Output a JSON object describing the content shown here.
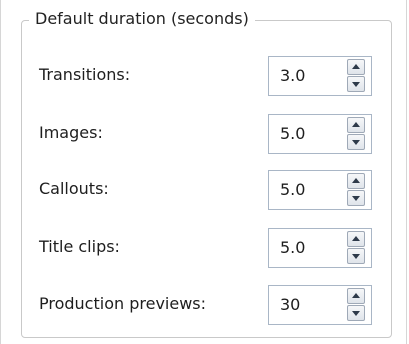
{
  "group": {
    "title": "Default duration (seconds)"
  },
  "fields": [
    {
      "label": "Transitions:",
      "value": "3.0"
    },
    {
      "label": "Images:",
      "value": "5.0"
    },
    {
      "label": "Callouts:",
      "value": "5.0"
    },
    {
      "label": "Title clips:",
      "value": "5.0"
    },
    {
      "label": "Production previews:",
      "value": "30"
    }
  ],
  "icons": {
    "increment": "spin-up-arrow-icon",
    "decrement": "spin-down-arrow-icon"
  },
  "colors": {
    "border": "#c9c9c9",
    "spin_border": "#a9b6c6",
    "text": "#1e1e1e"
  }
}
